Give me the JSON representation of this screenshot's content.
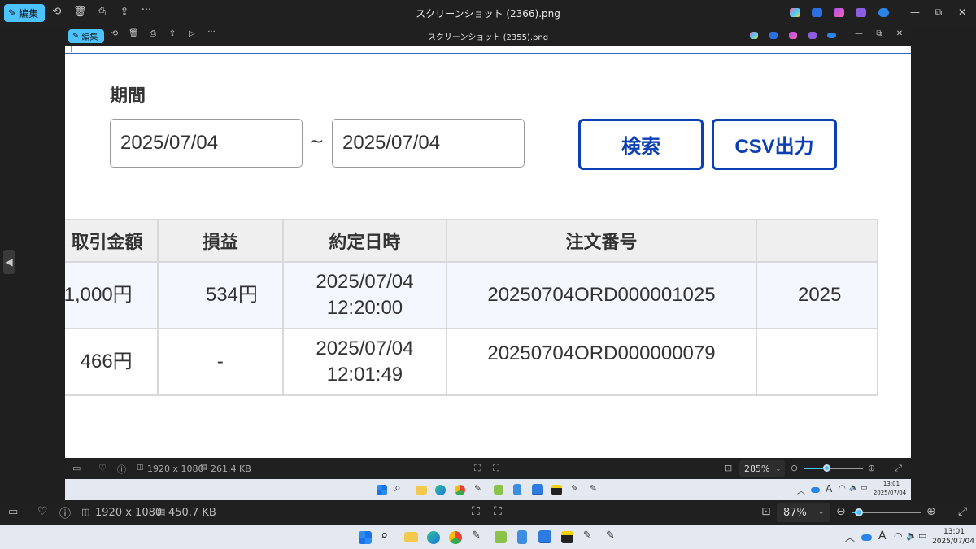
{
  "outer_window": {
    "edit_label": "編集",
    "title": "スクリーンショット (2366).png",
    "dimensions": "1920 x 1080",
    "file_size": "450.7 KB",
    "zoom": "87%",
    "zoom_fraction": 0.1
  },
  "inner_window": {
    "edit_label": "編集",
    "title": "スクリーンショット (2355).png",
    "dimensions": "1920 x 1080",
    "file_size": "261.4 KB",
    "zoom": "285%",
    "zoom_fraction": 0.38
  },
  "form": {
    "period_label": "期間",
    "date_from": "2025/07/04",
    "date_to": "2025/07/04",
    "separator": "~",
    "search_button": "検索",
    "csv_button": "CSV出力"
  },
  "table": {
    "headers": [
      "取引金額",
      "損益",
      "約定日時",
      "注文番号",
      ""
    ],
    "rows": [
      {
        "amount": "1,000円",
        "pnl": "534円",
        "date": "2025/07/04",
        "time": "12:20:00",
        "order": "20250704ORD000001025",
        "extra": "2025"
      },
      {
        "amount": "466円",
        "pnl": "-",
        "date": "2025/07/04",
        "time": "12:01:49",
        "order": "20250704ORD000000079",
        "extra": ""
      }
    ]
  },
  "taskbar": {
    "outer_time": "13:01",
    "outer_date": "2025/07/04",
    "inner_time": "13:01",
    "inner_date": "2025/07/04",
    "ime": "A"
  },
  "colors": {
    "accent_blue": "#0b3fb4",
    "viewer_accent": "#4cc2ff",
    "header_bg": "#efefef"
  }
}
